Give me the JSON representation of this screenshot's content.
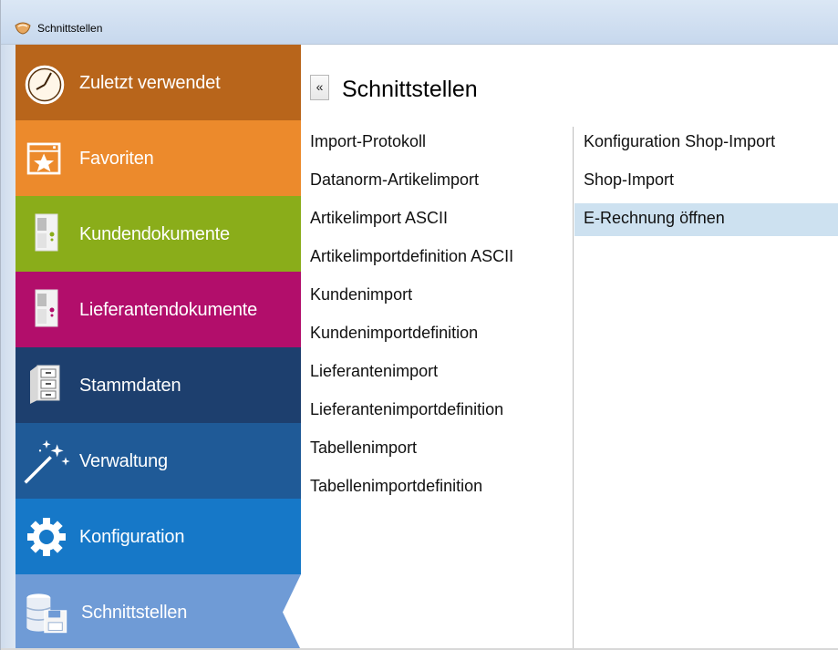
{
  "window": {
    "title": "Schnittstellen"
  },
  "sidebar": {
    "items": [
      {
        "label": "Zuletzt verwendet",
        "icon": "clock-icon",
        "color": "#b8651b"
      },
      {
        "label": "Favoriten",
        "icon": "star-window-icon",
        "color": "#ec8a2c"
      },
      {
        "label": "Kundendokumente",
        "icon": "binder-icon",
        "color": "#8aad1a"
      },
      {
        "label": "Lieferantendokumente",
        "icon": "binder-icon",
        "color": "#b20e6b"
      },
      {
        "label": "Stammdaten",
        "icon": "filing-cabinet-icon",
        "color": "#1d3f6e"
      },
      {
        "label": "Verwaltung",
        "icon": "magic-wand-icon",
        "color": "#1f5a97"
      },
      {
        "label": "Konfiguration",
        "icon": "gear-icon",
        "color": "#1678c8"
      },
      {
        "label": "Schnittstellen",
        "icon": "database-interface-icon",
        "color": "#6f9bd6",
        "active": true
      }
    ]
  },
  "main": {
    "back_label": "«",
    "title": "Schnittstellen",
    "column1": [
      "Import-Protokoll",
      "Datanorm-Artikelimport",
      "Artikelimport ASCII",
      "Artikelimportdefinition ASCII",
      "Kundenimport",
      "Kundenimportdefinition",
      "Lieferantenimport",
      "Lieferantenimportdefinition",
      "Tabellenimport",
      "Tabellenimportdefinition"
    ],
    "column2": [
      "Konfiguration Shop-Import",
      "Shop-Import",
      "E-Rechnung öffnen"
    ],
    "selected_item": "E-Rechnung öffnen",
    "selected_color": "#cde1f0"
  }
}
